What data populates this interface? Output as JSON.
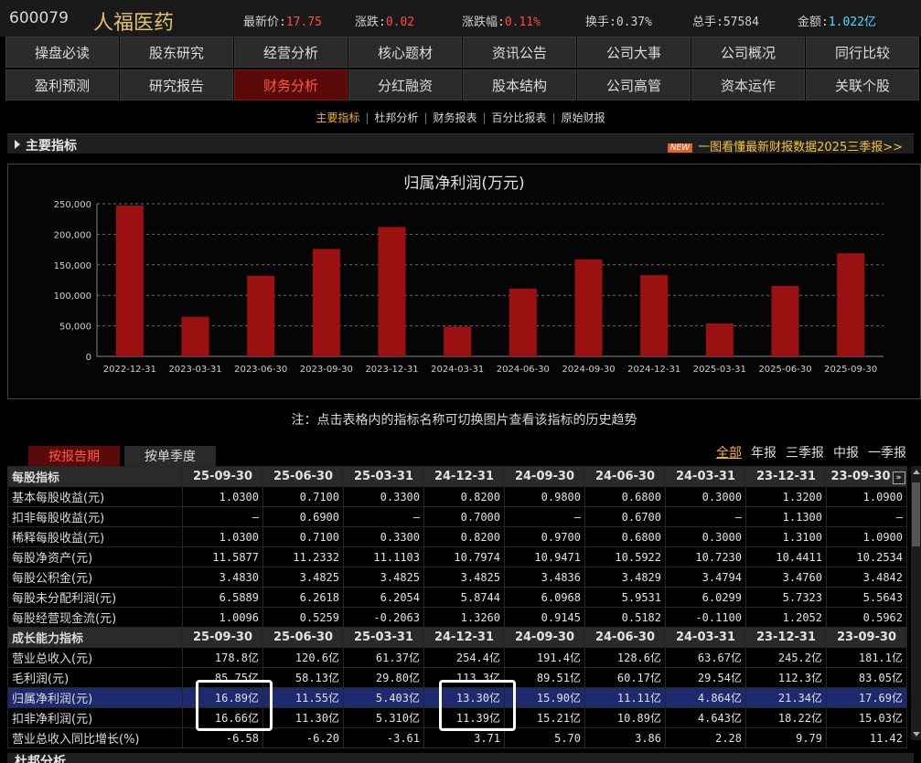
{
  "stock": {
    "code": "600079",
    "name": "人福医药",
    "price_label": "最新价:",
    "price": "17.75",
    "change_label": "涨跌:",
    "change": "0.02",
    "pct_label": "涨跌幅:",
    "pct": "0.11%",
    "turnover_label": "换手:",
    "turnover": "0.37%",
    "volume_label": "总手:",
    "volume": "57584",
    "amount_label": "金额:",
    "amount": "1.022亿"
  },
  "nav": {
    "row1": [
      "操盘必读",
      "股东研究",
      "经营分析",
      "核心题材",
      "资讯公告",
      "公司大事",
      "公司概况",
      "同行比较"
    ],
    "row2": [
      "盈利预测",
      "研究报告",
      "财务分析",
      "分红融资",
      "股本结构",
      "公司高管",
      "资本运作",
      "关联个股"
    ],
    "active": "财务分析"
  },
  "subtabs": [
    "主要指标",
    "杜邦分析",
    "财务报表",
    "百分比报表",
    "原始财报"
  ],
  "section": {
    "title": "主要指标",
    "news_badge": "NEW",
    "news_text": "一图看懂最新财报数据2025三季报>>"
  },
  "chart_data": {
    "type": "bar",
    "title": "归属净利润(万元)",
    "categories": [
      "2022-12-31",
      "2023-03-31",
      "2023-06-30",
      "2023-09-30",
      "2023-12-31",
      "2024-03-31",
      "2024-06-30",
      "2024-09-30",
      "2024-12-31",
      "2025-03-31",
      "2025-06-30",
      "2025-09-30"
    ],
    "values": [
      247000,
      65000,
      132000,
      176000,
      212000,
      48600,
      111100,
      159000,
      133000,
      54000,
      115500,
      168900
    ],
    "ylim": [
      0,
      250000
    ],
    "yticks": [
      "0",
      "50,000",
      "100,000",
      "150,000",
      "200,000",
      "250,000"
    ],
    "bar_color": "#9b1111",
    "grid": true
  },
  "note": "注：点击表格内的指标名称可切换图片查看该指标的历史趋势",
  "mode_tabs": [
    "按报告期",
    "按单季度"
  ],
  "periods": [
    "全部",
    "年报",
    "三季报",
    "中报",
    "一季报"
  ],
  "periods_active": "全部",
  "table": {
    "columns": [
      "25-09-30",
      "25-06-30",
      "25-03-31",
      "24-12-31",
      "24-09-30",
      "24-06-30",
      "24-03-31",
      "23-12-31",
      "23-09-30"
    ],
    "more_glyph": "»",
    "rows": [
      {
        "type": "hdr",
        "label": "每股指标",
        "values": [
          "25-09-30",
          "25-06-30",
          "25-03-31",
          "24-12-31",
          "24-09-30",
          "24-06-30",
          "24-03-31",
          "23-12-31",
          "23-09-30"
        ]
      },
      {
        "label": "基本每股收益(元)",
        "values": [
          "1.0300",
          "0.7100",
          "0.3300",
          "0.8200",
          "0.9800",
          "0.6800",
          "0.3000",
          "1.3200",
          "1.0900"
        ]
      },
      {
        "label": "扣非每股收益(元)",
        "values": [
          "—",
          "0.6900",
          "—",
          "0.7000",
          "—",
          "0.6700",
          "—",
          "1.1300",
          "—"
        ]
      },
      {
        "label": "稀释每股收益(元)",
        "values": [
          "1.0300",
          "0.7100",
          "0.3300",
          "0.8200",
          "0.9700",
          "0.6800",
          "0.3000",
          "1.3100",
          "1.0900"
        ]
      },
      {
        "label": "每股净资产(元)",
        "values": [
          "11.5877",
          "11.2332",
          "11.1103",
          "10.7974",
          "10.9471",
          "10.5922",
          "10.7230",
          "10.4411",
          "10.2534"
        ]
      },
      {
        "label": "每股公积金(元)",
        "values": [
          "3.4830",
          "3.4825",
          "3.4825",
          "3.4825",
          "3.4836",
          "3.4829",
          "3.4794",
          "3.4760",
          "3.4842"
        ]
      },
      {
        "label": "每股未分配利润(元)",
        "values": [
          "6.5889",
          "6.2618",
          "6.2054",
          "5.8744",
          "6.0968",
          "5.9531",
          "6.0299",
          "5.7323",
          "5.5643"
        ]
      },
      {
        "label": "每股经营现金流(元)",
        "values": [
          "1.0096",
          "0.5259",
          "-0.2063",
          "1.3260",
          "0.9145",
          "0.5182",
          "-0.1100",
          "1.2052",
          "0.5962"
        ]
      },
      {
        "type": "hdr",
        "label": "成长能力指标",
        "values": [
          "25-09-30",
          "25-06-30",
          "25-03-31",
          "24-12-31",
          "24-09-30",
          "24-06-30",
          "24-03-31",
          "23-12-31",
          "23-09-30"
        ]
      },
      {
        "label": "营业总收入(元)",
        "values": [
          "178.8亿",
          "120.6亿",
          "61.37亿",
          "254.4亿",
          "191.4亿",
          "128.6亿",
          "63.67亿",
          "245.2亿",
          "181.1亿"
        ]
      },
      {
        "label": "毛利润(元)",
        "values": [
          "85.75亿",
          "58.13亿",
          "29.80亿",
          "113.3亿",
          "89.51亿",
          "60.17亿",
          "29.54亿",
          "112.3亿",
          "83.05亿"
        ]
      },
      {
        "type": "hl",
        "label": "归属净利润(元)",
        "values": [
          "16.89亿",
          "11.55亿",
          "5.403亿",
          "13.30亿",
          "15.90亿",
          "11.11亿",
          "4.864亿",
          "21.34亿",
          "17.69亿"
        ]
      },
      {
        "label": "扣非净利润(元)",
        "values": [
          "16.66亿",
          "11.30亿",
          "5.310亿",
          "11.39亿",
          "15.21亿",
          "10.89亿",
          "4.643亿",
          "18.22亿",
          "15.03亿"
        ]
      },
      {
        "label": "营业总收入同比增长(%)",
        "values": [
          "-6.58",
          "-6.20",
          "-3.61",
          "3.71",
          "5.70",
          "3.86",
          "2.28",
          "9.79",
          "11.42"
        ]
      }
    ]
  },
  "bottom_section": "杜邦分析"
}
